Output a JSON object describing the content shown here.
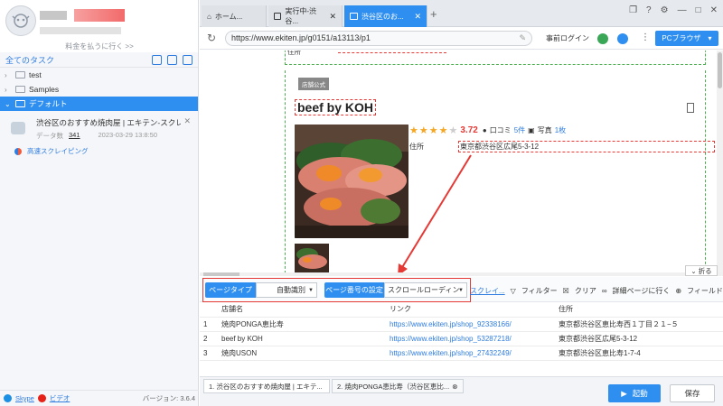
{
  "sidebar": {
    "upgrade_text": "料金を払うに行く >>",
    "all_tasks_label": "全てのタスク",
    "tree": [
      {
        "label": "test"
      },
      {
        "label": "Samples"
      },
      {
        "label": "デフォルト"
      }
    ],
    "task": {
      "title": "渋谷区のおすすめ焼肉屋 | エキテン-スクレ...",
      "count_label": "データ数",
      "count": "341",
      "date": "2023-03-29 13:8:50",
      "fast_label": "高速スクレイピング"
    },
    "footer": {
      "skype": "Skype",
      "video": "ビデオ",
      "version": "バージョン: 3.6.4"
    }
  },
  "tabs": [
    {
      "label": "ホーム..."
    },
    {
      "label": "実行中-渋谷..."
    },
    {
      "label": "渋谷区のお..."
    }
  ],
  "address": {
    "url": "https://www.ekiten.jp/g0151/a13113/p1",
    "login_label": "事前ログイン",
    "pc_browser_label": "PCブラウザ"
  },
  "webpage": {
    "prev_label": "住所",
    "badge": "店舗公式",
    "shop_name": "beef by KOH",
    "rating": "3.72",
    "reviews_label": "口コミ",
    "reviews_count": "5件",
    "photos_label": "写真",
    "photos_count": "1枚",
    "address_label": "住所",
    "address_value": "東京都渋谷区広尾5-3-12"
  },
  "collapse_label": "折る",
  "toolbar": {
    "page_type_label": "ページタイプ",
    "page_type_value": "自動識別",
    "page_number_label": "ページ番号の設定",
    "page_number_value": "スクロールローディン",
    "skip_label": "スクレイ...",
    "filter_label": "フィルター",
    "clear_label": "クリア",
    "detail_label": "詳細ページに行く",
    "add_field_label": "フィールドを追加"
  },
  "table": {
    "headers": [
      "",
      "店舗名",
      "リンク",
      "住所"
    ],
    "rows": [
      [
        "1",
        "焼肉PONGA恵比寿",
        "https://www.ekiten.jp/shop_92338166/",
        "東京都渋谷区恵比寿西１丁目２１−５"
      ],
      [
        "2",
        "beef by KOH",
        "https://www.ekiten.jp/shop_53287218/",
        "東京都渋谷区広尾5-3-12"
      ],
      [
        "3",
        "焼肉USON",
        "https://www.ekiten.jp/shop_27432249/",
        "東京都渋谷区恵比寿1-7-4"
      ]
    ]
  },
  "bottom_tabs": [
    {
      "label": "1. 渋谷区のおすすめ焼肉屋 | エキテ..."
    },
    {
      "label": "2. 焼肉PONGA恵比寿（渋谷区恵比..."
    }
  ],
  "buttons": {
    "start_label": "起動",
    "save_label": "保存"
  },
  "colors": {
    "accent": "#2f8ff0",
    "highlight_red": "#e53935",
    "star": "#f5a623"
  }
}
